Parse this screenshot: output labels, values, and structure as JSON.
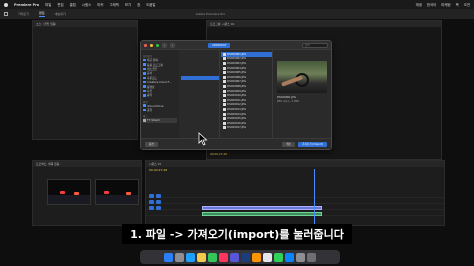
{
  "menubar": {
    "app_name": "Premiere Pro",
    "items": [
      "파일",
      "편집",
      "클립",
      "시퀀스",
      "마커",
      "그래픽",
      "보기",
      "창",
      "도움말"
    ],
    "right_items": [
      "재생",
      "한국어",
      "마케팅",
      "목",
      "오전"
    ]
  },
  "header": {
    "tabs": [
      "가져오기",
      "편집",
      "내보내기"
    ],
    "active_tab": "편집",
    "title": "Adobe Premiere Pro"
  },
  "source_monitor": {
    "title": "소스: (클립 없음)"
  },
  "program_monitor": {
    "title": "프로그램: 시퀀스 01",
    "timecode": "00;00;27;26"
  },
  "project_panel": {
    "title": "프로젝트: 제목 없음",
    "timecode": "00;00;27;26"
  },
  "timeline": {
    "title": "시퀀스 01",
    "timecode": "00;00;27;26"
  },
  "dialog": {
    "folder_name": "220602GT",
    "search_placeholder": "검색",
    "sidebar": {
      "favorites_label": "즐겨찾기",
      "favorites": [
        "최근 항목",
        "응용 프로그램",
        "데스크탑",
        "문서",
        "다운로드",
        "Creative Cloud F...",
        "동영상",
        "사진",
        "음악"
      ],
      "locations_label": "위치",
      "locations": [
        "iCloud Drive",
        "공유"
      ],
      "tags_label": "태그",
      "tags": [
        "T7 Shield"
      ]
    },
    "files": [
      "DSC00001.JPG",
      "DSC00002.JPG",
      "DSC00003.JPG",
      "DSC00004.JPG",
      "DSC00005.JPG",
      "DSC00006.JPG",
      "DSC00007.JPG",
      "DSC00008.JPG",
      "DSC00009.JPG",
      "DSC00010.JPG",
      "DSC00011.JPG",
      "DSC00012.JPG",
      "DSC00013.JPG",
      "DSC00014.JPG",
      "DSC00015.JPG",
      "DSC00016.JPG",
      "DSC00017.JPG"
    ],
    "selected_index": 0,
    "preview": {
      "name": "DSC00001.JPG",
      "meta": "JPEG 이미지 - 6.3MB"
    },
    "options_button": "옵션",
    "cancel_button": "취소",
    "import_button": "가져오기 (Import)"
  },
  "caption": "1. 파일 -> 가져오기(import)를 눌러줍니다",
  "colors": {
    "accent": "#2f6fd6",
    "clip_video": "#6c78d8",
    "clip_audio": "#3d8a5a"
  }
}
